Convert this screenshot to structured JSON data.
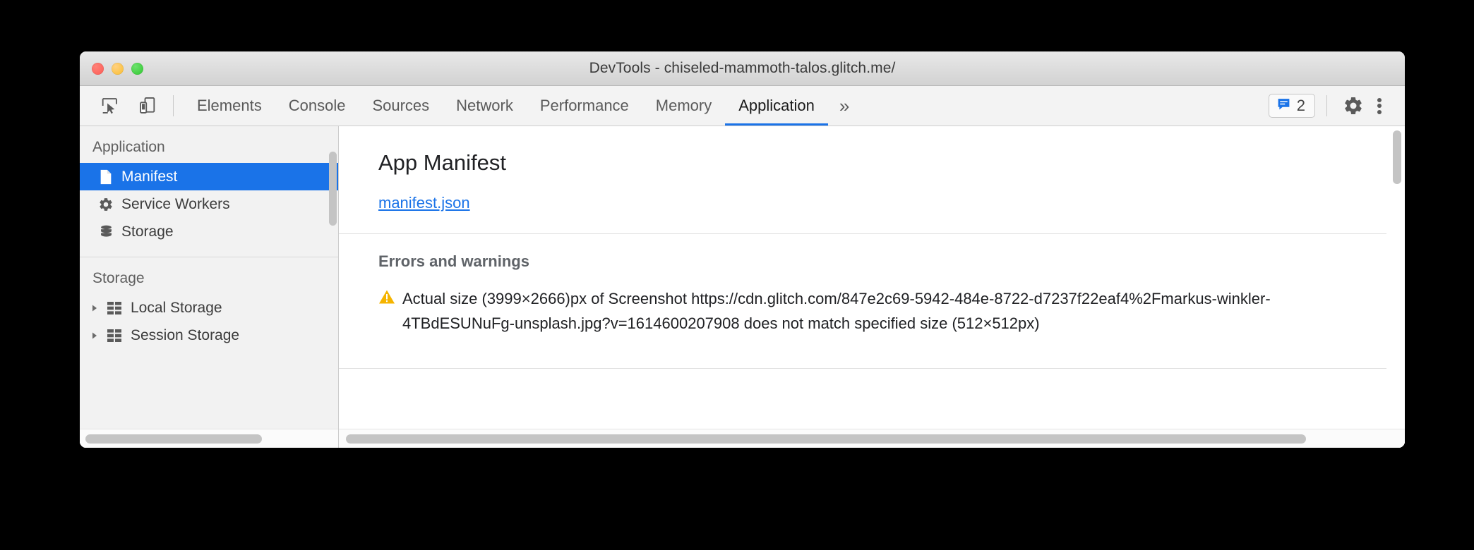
{
  "window": {
    "title": "DevTools - chiseled-mammoth-talos.glitch.me/",
    "traffic_lights": [
      {
        "name": "close",
        "color": "#fc5b54"
      },
      {
        "name": "minimize",
        "color": "#f9bd2e"
      },
      {
        "name": "maximize",
        "color": "#2fc62f"
      }
    ]
  },
  "toolbar": {
    "inspect_icon": "inspect-cursor-icon",
    "device_icon": "device-toolbar-icon",
    "tabs": [
      {
        "label": "Elements",
        "active": false
      },
      {
        "label": "Console",
        "active": false
      },
      {
        "label": "Sources",
        "active": false
      },
      {
        "label": "Network",
        "active": false
      },
      {
        "label": "Performance",
        "active": false
      },
      {
        "label": "Memory",
        "active": false
      },
      {
        "label": "Application",
        "active": true
      }
    ],
    "overflow_label": "»",
    "messages_badge": {
      "icon": "message-bubble-icon",
      "count": "2",
      "accent": "#1a73e8"
    },
    "settings_icon": "gear-icon",
    "more_icon": "vertical-dots-icon",
    "active_tab_underline_color": "#1a73e8"
  },
  "sidebar": {
    "sections": [
      {
        "title": "Application",
        "items": [
          {
            "label": "Manifest",
            "icon": "document-icon",
            "selected": true,
            "twisty": false
          },
          {
            "label": "Service Workers",
            "icon": "gear-icon",
            "selected": false,
            "twisty": false
          },
          {
            "label": "Storage",
            "icon": "database-icon",
            "selected": false,
            "twisty": false
          }
        ]
      },
      {
        "title": "Storage",
        "items": [
          {
            "label": "Local Storage",
            "icon": "table-grid-icon",
            "selected": false,
            "twisty": true
          },
          {
            "label": "Session Storage",
            "icon": "table-grid-icon",
            "selected": false,
            "twisty": true
          }
        ]
      }
    ],
    "selection_color": "#1a73e8"
  },
  "main": {
    "panel_title": "App Manifest",
    "manifest_link": "manifest.json",
    "errors_title": "Errors and warnings",
    "warning": {
      "icon": "warning-triangle-icon",
      "icon_color": "#f5b400",
      "text": "Actual size (3999×2666)px of Screenshot https://cdn.glitch.com/847e2c69-5942-484e-8722-d7237f22eaf4%2Fmarkus-winkler-4TBdESUNuFg-unsplash.jpg?v=1614600207908 does not match specified size (512×512px)"
    }
  }
}
